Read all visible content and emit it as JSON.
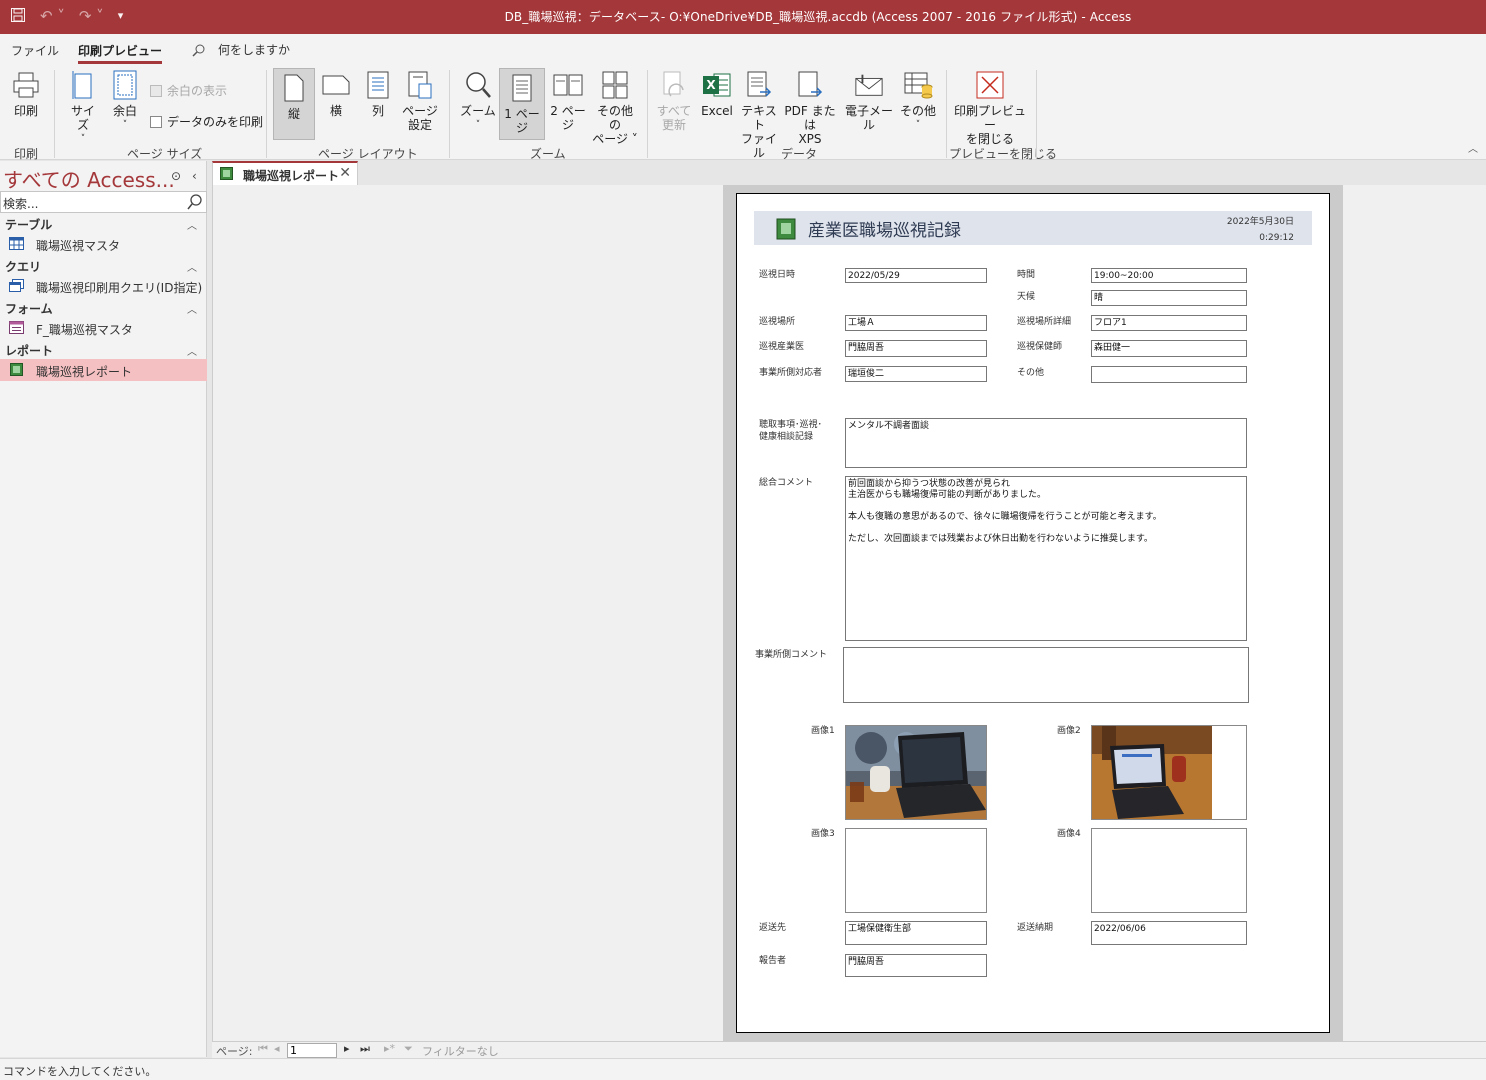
{
  "window": {
    "title": "DB_職場巡視：データベース- O:¥OneDrive¥DB_職場巡視.accdb (Access 2007 - 2016 ファイル形式)  -  Access"
  },
  "menu": {
    "file": "ファイル",
    "print_preview": "印刷プレビュー",
    "tell_me": "何をしますか"
  },
  "ribbon": {
    "print": "印刷",
    "size": "サイズ",
    "margins": "余白",
    "show_margins": "余白の表示",
    "print_data_only": "データのみを印刷",
    "portrait": "縦",
    "landscape": "横",
    "columns": "列",
    "page_setup_1": "ページ",
    "page_setup_2": "設定",
    "zoom": "ズーム",
    "one_page": "1 ページ",
    "two_pages": "2 ページ",
    "more_pages_1": "その他の",
    "more_pages_2": "ページ",
    "refresh_all_1": "すべて",
    "refresh_all_2": "更新",
    "excel": "Excel",
    "text_file_1": "テキスト",
    "text_file_2": "ファイル",
    "pdf_xps_1": "PDF または",
    "pdf_xps_2": "XPS",
    "email": "電子メール",
    "more": "その他",
    "close_preview_1": "印刷プレビュー",
    "close_preview_2": "を閉じる",
    "group_print": "印刷",
    "group_page_size": "ページ サイズ",
    "group_page_layout": "ページ レイアウト",
    "group_zoom": "ズーム",
    "group_data": "データ",
    "group_close": "プレビューを閉じる"
  },
  "nav": {
    "title": "すべての Access...",
    "search_placeholder": "検索...",
    "categories": [
      {
        "name": "テーブル",
        "items": [
          "職場巡視マスタ"
        ]
      },
      {
        "name": "クエリ",
        "items": [
          "職場巡視印刷用クエリ(ID指定)"
        ]
      },
      {
        "name": "フォーム",
        "items": [
          "F_職場巡視マスタ"
        ]
      },
      {
        "name": "レポート",
        "items": [
          "職場巡視レポート"
        ]
      }
    ]
  },
  "doc_tab": {
    "label": "職場巡視レポート"
  },
  "report": {
    "title": "産業医職場巡視記録",
    "date": "2022年5月30日",
    "time": "0:29:12",
    "fields": {
      "visit_date_label": "巡視日時",
      "visit_date": "2022/05/29",
      "time_label": "時間",
      "time": "19:00~20:00",
      "weather_label": "天候",
      "weather": "晴",
      "location_label": "巡視場所",
      "location": "工場Ａ",
      "location_detail_label": "巡視場所詳細",
      "location_detail": "フロア1",
      "doctor_label": "巡視産業医",
      "doctor": "門脇周吾",
      "nurse_label": "巡視保健師",
      "nurse": "森田健一",
      "contact_label": "事業所側対応者",
      "contact": "瑞垣俊二",
      "other_label": "その他",
      "other": "",
      "hearing_label": "聴取事項･巡視･\n健康相談記録",
      "hearing": "メンタル不調者面談",
      "comment_label": "総合コメント",
      "comment": "前回面談から抑うつ状態の改善が見られ\n主治医からも職場復帰可能の判断がありました。\n\n本人も復職の意思があるので、徐々に職場復帰を行うことが可能と考えます。\n\nただし、次回面談までは残業および休日出勤を行わないように推奨します。",
      "site_comment_label": "事業所側コメント",
      "site_comment": "",
      "image1_label": "画像1",
      "image2_label": "画像2",
      "image3_label": "画像3",
      "image4_label": "画像4",
      "return_to_label": "返送先",
      "return_to": "工場保健衛生部",
      "return_deadline_label": "返送納期",
      "return_deadline": "2022/06/06",
      "reporter_label": "報告者",
      "reporter": "門脇周吾"
    }
  },
  "record_nav": {
    "page_label": "ページ:",
    "page_value": "1",
    "filter": "フィルターなし"
  },
  "status": {
    "text": "コマンドを入力してください。"
  },
  "colors": {
    "accent": "#a4373a",
    "nav_selected": "#f5c0c2",
    "report_header": "#dfe3ec"
  }
}
